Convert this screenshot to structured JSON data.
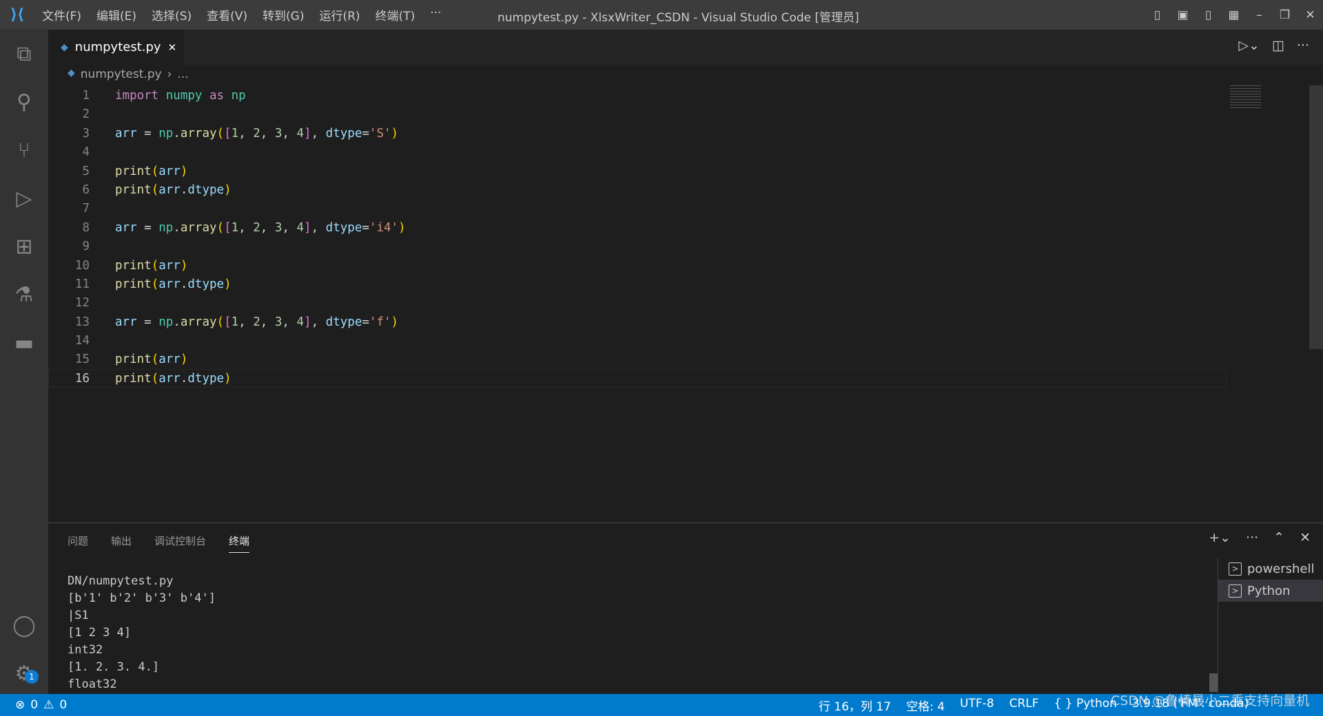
{
  "titlebar": {
    "menu": [
      "文件(F)",
      "编辑(E)",
      "选择(S)",
      "查看(V)",
      "转到(G)",
      "运行(R)",
      "终端(T)",
      "···"
    ],
    "title": "numpytest.py - XlsxWriter_CSDN - Visual Studio Code [管理员]"
  },
  "tab": {
    "label": "numpytest.py",
    "close": "✕"
  },
  "breadcrumb": {
    "file": "numpytest.py",
    "sep": "›",
    "rest": "..."
  },
  "editor": {
    "current_line": 16,
    "lines": [
      [
        [
          "kw",
          "import"
        ],
        [
          "op",
          " "
        ],
        [
          "mod",
          "numpy"
        ],
        [
          "op",
          " "
        ],
        [
          "kw",
          "as"
        ],
        [
          "op",
          " "
        ],
        [
          "mod",
          "np"
        ]
      ],
      [],
      [
        [
          "var",
          "arr"
        ],
        [
          "op",
          " = "
        ],
        [
          "mod",
          "np"
        ],
        [
          "op",
          "."
        ],
        [
          "fn",
          "array"
        ],
        [
          "b1",
          "("
        ],
        [
          "b2",
          "["
        ],
        [
          "num",
          "1"
        ],
        [
          "op",
          ", "
        ],
        [
          "num",
          "2"
        ],
        [
          "op",
          ", "
        ],
        [
          "num",
          "3"
        ],
        [
          "op",
          ", "
        ],
        [
          "num",
          "4"
        ],
        [
          "b2",
          "]"
        ],
        [
          "op",
          ", "
        ],
        [
          "var",
          "dtype"
        ],
        [
          "op",
          "="
        ],
        [
          "str",
          "'S'"
        ],
        [
          "b1",
          ")"
        ]
      ],
      [],
      [
        [
          "fn",
          "print"
        ],
        [
          "b1",
          "("
        ],
        [
          "var",
          "arr"
        ],
        [
          "b1",
          ")"
        ]
      ],
      [
        [
          "fn",
          "print"
        ],
        [
          "b1",
          "("
        ],
        [
          "var",
          "arr"
        ],
        [
          "op",
          "."
        ],
        [
          "var",
          "dtype"
        ],
        [
          "b1",
          ")"
        ]
      ],
      [],
      [
        [
          "var",
          "arr"
        ],
        [
          "op",
          " = "
        ],
        [
          "mod",
          "np"
        ],
        [
          "op",
          "."
        ],
        [
          "fn",
          "array"
        ],
        [
          "b1",
          "("
        ],
        [
          "b2",
          "["
        ],
        [
          "num",
          "1"
        ],
        [
          "op",
          ", "
        ],
        [
          "num",
          "2"
        ],
        [
          "op",
          ", "
        ],
        [
          "num",
          "3"
        ],
        [
          "op",
          ", "
        ],
        [
          "num",
          "4"
        ],
        [
          "b2",
          "]"
        ],
        [
          "op",
          ", "
        ],
        [
          "var",
          "dtype"
        ],
        [
          "op",
          "="
        ],
        [
          "str",
          "'i4'"
        ],
        [
          "b1",
          ")"
        ]
      ],
      [],
      [
        [
          "fn",
          "print"
        ],
        [
          "b1",
          "("
        ],
        [
          "var",
          "arr"
        ],
        [
          "b1",
          ")"
        ]
      ],
      [
        [
          "fn",
          "print"
        ],
        [
          "b1",
          "("
        ],
        [
          "var",
          "arr"
        ],
        [
          "op",
          "."
        ],
        [
          "var",
          "dtype"
        ],
        [
          "b1",
          ")"
        ]
      ],
      [],
      [
        [
          "var",
          "arr"
        ],
        [
          "op",
          " = "
        ],
        [
          "mod",
          "np"
        ],
        [
          "op",
          "."
        ],
        [
          "fn",
          "array"
        ],
        [
          "b1",
          "("
        ],
        [
          "b2",
          "["
        ],
        [
          "num",
          "1"
        ],
        [
          "op",
          ", "
        ],
        [
          "num",
          "2"
        ],
        [
          "op",
          ", "
        ],
        [
          "num",
          "3"
        ],
        [
          "op",
          ", "
        ],
        [
          "num",
          "4"
        ],
        [
          "b2",
          "]"
        ],
        [
          "op",
          ", "
        ],
        [
          "var",
          "dtype"
        ],
        [
          "op",
          "="
        ],
        [
          "str",
          "'f'"
        ],
        [
          "b1",
          ")"
        ]
      ],
      [],
      [
        [
          "fn",
          "print"
        ],
        [
          "b1",
          "("
        ],
        [
          "var",
          "arr"
        ],
        [
          "b1",
          ")"
        ]
      ],
      [
        [
          "fn",
          "print"
        ],
        [
          "b1",
          "("
        ],
        [
          "var",
          "arr"
        ],
        [
          "op",
          "."
        ],
        [
          "var",
          "dtype"
        ],
        [
          "b1",
          ")"
        ]
      ]
    ]
  },
  "panel": {
    "tabs": [
      "问题",
      "输出",
      "调试控制台",
      "终端"
    ],
    "active_tab": "终端",
    "terminal_output": [
      "DN/numpytest.py",
      "[b'1' b'2' b'3' b'4']",
      "|S1",
      "[1 2 3 4]",
      "int32",
      "[1. 2. 3. 4.]",
      "float32"
    ],
    "terminals": [
      {
        "name": "powershell",
        "selected": false
      },
      {
        "name": "Python",
        "selected": true
      }
    ]
  },
  "status": {
    "errors": "0",
    "warnings": "0",
    "position": "行 16，列 17",
    "spaces": "空格: 4",
    "encoding": "UTF-8",
    "eol": "CRLF",
    "language": "Python",
    "interpreter": "3.9.18 ('FM': conda)"
  },
  "activity_badge": "1",
  "watermark": "CSDN @鲁棒最小二乘支持向量机",
  "colors": {
    "accent": "#007acc",
    "titlebar": "#3c3c3c",
    "activitybar": "#333333",
    "editor": "#1e1e1e"
  }
}
